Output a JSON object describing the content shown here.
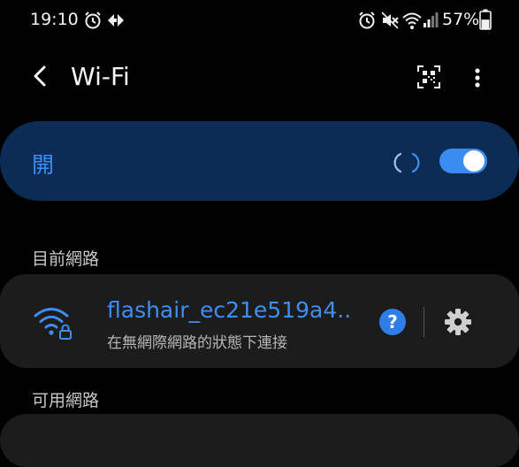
{
  "status_bar": {
    "time": "19:10",
    "left_icons": [
      "alarm-icon",
      "data-transfer-icon"
    ],
    "right_icons": [
      "alarm-icon",
      "mute-icon",
      "wifi-icon",
      "signal-icon",
      "battery-icon"
    ],
    "battery_text": "57%",
    "battery_level": 0.57
  },
  "app_bar": {
    "title": "Wi-Fi"
  },
  "master_switch": {
    "label": "開",
    "on": true,
    "accent": "#3b8cf2"
  },
  "current_network": {
    "header": "目前網路",
    "name": "flashair_ec21e519a4..",
    "status": "在無網際網路的狀態下連接",
    "help_label": "?"
  },
  "available": {
    "header": "可用網路"
  }
}
